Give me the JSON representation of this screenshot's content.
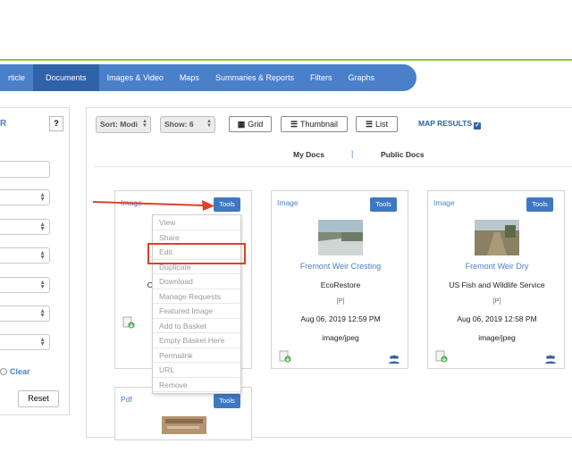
{
  "nav": {
    "items": [
      "rticle",
      "Documents",
      "Images & Video",
      "Maps",
      "Summaries & Reports",
      "Filters",
      "Graphs"
    ],
    "active_index": 1
  },
  "left_panel": {
    "title": "R",
    "help": "?",
    "clear": "Clear",
    "reset": "Reset"
  },
  "toolbar": {
    "sort_label": "Sort: Modi",
    "show_label": "Show: 6",
    "grid": "Grid",
    "thumbnail": "Thumbnail",
    "list": "List",
    "map_results": "MAP RESULTS"
  },
  "doc_tabs": {
    "my_docs": "My Docs",
    "separator": "|",
    "public_docs": "Public Docs"
  },
  "cards": [
    {
      "type": "Image",
      "tools": "Tools",
      "title": "",
      "source": "O",
      "p": "",
      "date": "",
      "mime": "",
      "thumb_colors": [
        "#8e8b83",
        "#d8d4cc"
      ]
    },
    {
      "type": "Image",
      "tools": "Tools",
      "title": "Fremont Weir Cresting",
      "source": "EcoRestore",
      "p": "[P]",
      "date": "Aug 06, 2019 12:59 PM",
      "mime": "image/jpeg",
      "thumb_colors": [
        "#7a8c95",
        "#c8d2c9"
      ]
    },
    {
      "type": "Image",
      "tools": "Tools",
      "title": "Fremont Weir Dry",
      "source": "US Fish and Wildlife Service",
      "p": "[P]",
      "date": "Aug 06, 2019 12:58 PM",
      "mime": "image/jpeg",
      "thumb_colors": [
        "#8a7e62",
        "#a9b0a0"
      ]
    },
    {
      "type": "Pdf",
      "tools": "Tools",
      "title": "",
      "source": "",
      "p": "",
      "date": "",
      "mime": "",
      "thumb_colors": [
        "#9a7a58",
        "#c9b18a"
      ]
    }
  ],
  "tools_menu": {
    "items": [
      "View",
      "Share",
      "Edit",
      "Duplicate",
      "Download",
      "Manage Requests",
      "Featured Image",
      "Add to Basket",
      "Empty Basket Here",
      "Permalink",
      "URL",
      "Remove"
    ],
    "highlighted": "Edit"
  },
  "colors": {
    "nav_bg": "#4a7fc9",
    "nav_active": "#2f62a8",
    "accent_green": "#8bc34a",
    "annotation_red": "#e0402a",
    "link_blue": "#4a7fc9"
  }
}
